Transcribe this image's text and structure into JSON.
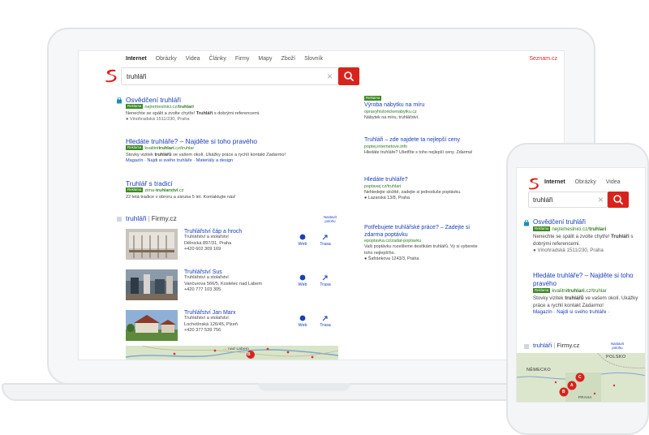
{
  "laptop": {
    "nav": [
      "Internet",
      "Obrázky",
      "Videa",
      "Články",
      "Firmy",
      "Mapy",
      "Zboží",
      "Slovník"
    ],
    "seznam_link": "Seznam.cz",
    "search": {
      "value": "truhláři"
    },
    "results": [
      {
        "title": "Osvědčení truhláři",
        "badge": "Reklama",
        "url_prefix": "nejremeslnici.cz/",
        "url_bold": "truhlari",
        "desc_a": "Nenechte se spálit a zvolte chytře! ",
        "desc_bold": "Truhláři",
        "desc_b": " s dobrými referencemi.",
        "address": "Vinohradská 1511/230, Praha"
      },
      {
        "title": "Hledáte truhláře? – Najděte si toho pravého",
        "badge": "Reklama",
        "url_prefix": "kvalitni",
        "url_bold": "truhlari",
        "url_suffix": ".cz/truhlar",
        "desc_a": "Stovky vizitek ",
        "desc_bold": "truhlářů",
        "desc_b": " ve vašem okolí. Ukážky práce a rychlí kontakt Zadarmo!",
        "links": "Magazín  ·  Najdi si svého truhláře  ·  Materiály a design"
      },
      {
        "title": "Truhlář s tradicí",
        "badge": "Reklama",
        "url_prefix": "zima-",
        "url_bold": "truhlarstvi",
        "url_suffix": ".cz",
        "desc": "22 letá tradice v obroru a záruka 5 let. Kontaktujte nás!"
      }
    ],
    "firmy": {
      "query": "truhláři",
      "sep": "|",
      "source": "Firmy.cz",
      "settings": [
        "Nastavit",
        "polohu"
      ],
      "web_label": "Web",
      "route_label": "Trasa",
      "items": [
        {
          "name": "Truhlářství čáp a hroch",
          "category": "Truhlářství a stolařství",
          "address": "Dělnická 897/31, Praha",
          "phone": "+420 602 309 169"
        },
        {
          "name": "Truhlářství Sus",
          "category": "Truhlářství a stolařství",
          "address": "Vančurova 566/5, Kostelec nad Labem",
          "phone": "+420 777 103 305"
        },
        {
          "name": "Truhlářství Jan Marx",
          "category": "Truhlářství a stolařství",
          "address": "Lochotínská 126/45, Plzeň",
          "phone": "+420 377 539 756"
        }
      ],
      "map_label": "... nad Labem",
      "map_pin": "B"
    },
    "ads": [
      {
        "badge": "Reklama",
        "title": "Výroba nábytku na míru",
        "url": "opravyhistorickenabytku.cz",
        "desc": "Nábytek na míru, truhlářství."
      },
      {
        "title": "Truhláři – zde najdete ta nejlepší ceny",
        "url": "poptej.internetove.info",
        "desc": "Hledáte truhláře? Ušetříte s toho nejlepší ceny. Zdarma!"
      },
      {
        "title": "Hledáte truhláře?",
        "url": "poptavej.cz/truhlari",
        "desc": "Nehledejte složitě, zadejte si jednoduše poptávku.",
        "address": "Lazarská 13/8, Praha"
      },
      {
        "title": "Potřebujete truhlářské práce? – Zadejte si zdarma poptávku",
        "url": "epoptavka.cz/zadat-poptavku",
        "desc": "Vaši poptávku rozešleme desítkám truhlářů. Vy si vyberete toho nejlepšího.",
        "address": "Šafránkova 1243/3, Praha"
      }
    ]
  },
  "phone": {
    "nav": [
      "Internet",
      "Obrázky",
      "Videa"
    ],
    "search": {
      "value": "truhláři"
    },
    "results": [
      {
        "title": "Osvědčení truhláři",
        "badge": "Reklama",
        "url_prefix": "nejremeslnici.cz/",
        "url_bold": "truhlari",
        "desc_a": "Nenechte se spálit a zvolte chytře! ",
        "desc_bold": "Truhláři",
        "desc_b": " s dobrými referencemi.",
        "address": "Vinohradská 1511/230, Praha"
      },
      {
        "title": "Hledáte truhláře? – Najděte si toho pravého",
        "badge": "Reklama",
        "url_prefix": "kvalitni",
        "url_bold": "truhlari",
        "url_suffix": ".cz/truhlar",
        "desc_a": "Stovky vizitek ",
        "desc_bold": "truhlářů",
        "desc_b": " ve vašem okolí. Ukážky práce a rychlí kontakt Zadarmo!",
        "links": "Magazín  ·  Najdi si svého truhláře  ·"
      }
    ],
    "firmy": {
      "query": "truhláři",
      "sep": "|",
      "source": "Firmy.cz",
      "settings": [
        "Nastavit",
        "polohu"
      ],
      "map_labels": [
        "POLSKO",
        "NĚMECKO",
        "PRAHA"
      ],
      "map_pins": [
        "B",
        "A",
        "C"
      ]
    }
  },
  "colors": {
    "brand_red": "#d8231d",
    "link_blue": "#1a3fb7",
    "url_green": "#2d7a1f",
    "badge_green": "#3a8a22"
  }
}
